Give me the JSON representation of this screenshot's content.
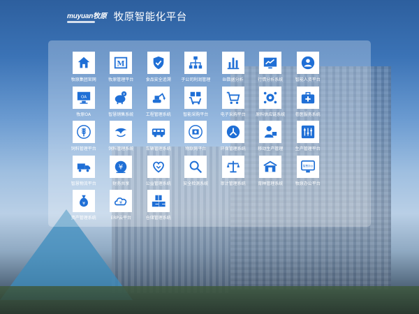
{
  "header": {
    "logo_text": "muyuan牧原",
    "title": "牧原智能化平台"
  },
  "colors": {
    "accent": "#1f6fd6",
    "label": "#ffffff"
  },
  "apps": [
    {
      "label": "牧原集团官网",
      "icon": "home-icon"
    },
    {
      "label": "牧原管理平台",
      "icon": "m-letter-icon"
    },
    {
      "label": "食品安全追溯",
      "icon": "shield-check-icon"
    },
    {
      "label": "子公司利润管理",
      "icon": "org-chart-icon"
    },
    {
      "label": "BI数据分析",
      "icon": "bar-chart-icon"
    },
    {
      "label": "行情分析系统",
      "icon": "trend-chart-icon"
    },
    {
      "label": "智能人资平台",
      "icon": "people-icon"
    },
    {
      "label": "牧原OA",
      "icon": "oa-monitor-icon"
    },
    {
      "label": "智慧销售系统",
      "icon": "pig-sales-icon"
    },
    {
      "label": "工程管理系统",
      "icon": "excavator-icon"
    },
    {
      "label": "智能采购平台",
      "icon": "shopping-cart-icon"
    },
    {
      "label": "电子采购平台",
      "icon": "cart-icon"
    },
    {
      "label": "原料供应链系统",
      "icon": "gear-network-icon"
    },
    {
      "label": "卷医服务系统",
      "icon": "medical-kit-icon"
    },
    {
      "label": "饲料管理平台",
      "icon": "wheat-icon"
    },
    {
      "label": "饲料管理系统",
      "icon": "bird-icon"
    },
    {
      "label": "车辆管理系统",
      "icon": "bus-icon"
    },
    {
      "label": "物联网平台",
      "icon": "iot-icon"
    },
    {
      "label": "环保管理系统",
      "icon": "recycle-icon"
    },
    {
      "label": "移动生产管理",
      "icon": "person-card-icon"
    },
    {
      "label": "生产管理平台",
      "icon": "sliders-icon"
    },
    {
      "label": "智慧物流平台",
      "icon": "truck-icon"
    },
    {
      "label": "财务共享",
      "icon": "yen-coin-icon"
    },
    {
      "label": "公益管理系统",
      "icon": "heart-hands-icon"
    },
    {
      "label": "安全检测系统",
      "icon": "magnifier-icon"
    },
    {
      "label": "审计管理系统",
      "icon": "scale-icon"
    },
    {
      "label": "育种管理系统",
      "icon": "barn-icon"
    },
    {
      "label": "牧原办公平台",
      "icon": "smart-office-icon"
    },
    {
      "label": "资产管理系统",
      "icon": "money-bag-icon"
    },
    {
      "label": "ERP云平台",
      "icon": "cloud-yen-icon"
    },
    {
      "label": "仓储管理系统",
      "icon": "boxes-icon"
    }
  ]
}
